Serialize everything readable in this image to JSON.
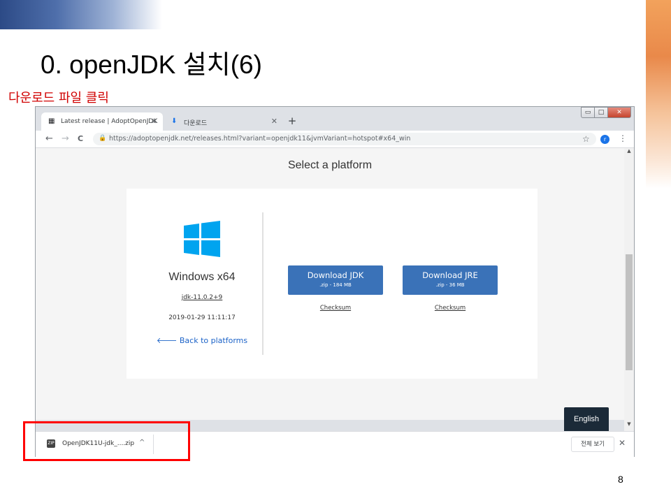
{
  "slide": {
    "title": "0. openJDK 설치(6)",
    "caption": "다운로드 파일 클릭",
    "page_number": "8"
  },
  "browser": {
    "tabs": [
      {
        "label": "Latest release | AdoptOpenJDK",
        "icon": "grid-icon",
        "close": "✕"
      },
      {
        "label": "다운로드",
        "icon": "download-icon",
        "close": "✕"
      }
    ],
    "new_tab": "+",
    "window_controls": {
      "minimize": "▭",
      "maximize": "□",
      "close": "✕"
    },
    "nav": {
      "back": "←",
      "forward": "→",
      "reload": "C"
    },
    "url": "https://adoptopenjdk.net/releases.html?variant=openjdk11&jvmVariant=hotspot#x64_win",
    "profile_initial": "r",
    "menu_icon": "⋮",
    "star_icon": "☆"
  },
  "page": {
    "heading": "Select a platform",
    "platform": {
      "name": "Windows x64",
      "version": "jdk-11.0.2+9",
      "date": "2019-01-29 11:11:17",
      "back_link": "Back to platforms"
    },
    "downloads": [
      {
        "label": "Download JDK",
        "size": ".zip - 184 MB",
        "checksum": "Checksum"
      },
      {
        "label": "Download JRE",
        "size": ".zip - 36 MB",
        "checksum": "Checksum"
      }
    ],
    "language_button": "English"
  },
  "download_shelf": {
    "file_name": "OpenJDK11U-jdk_....zip",
    "file_icon_text": "ZIP",
    "show_all": "전체 보기",
    "close": "✕",
    "caret": "^"
  },
  "colors": {
    "accent_button": "#3a72b8",
    "footer": "#1b2a38",
    "highlight": "#ff0000",
    "caption": "#d00000"
  }
}
